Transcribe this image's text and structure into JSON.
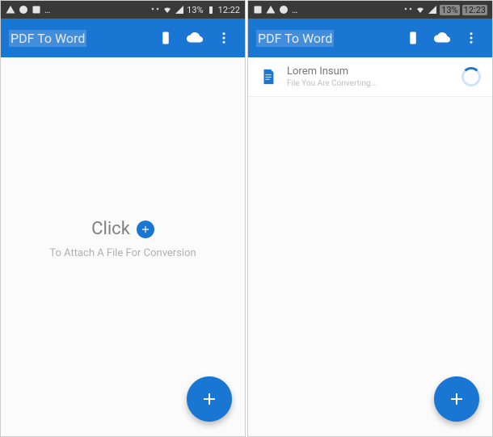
{
  "screen_left": {
    "status": {
      "battery_pct": "13%",
      "clock": "12:22"
    },
    "appbar": {
      "title": "PDF To Word"
    },
    "cta": {
      "click_label": "Click",
      "subtext": "To Attach A File For Conversion"
    }
  },
  "screen_right": {
    "status": {
      "battery_pct": "13%",
      "clock": "12:23"
    },
    "appbar": {
      "title": "PDF To Word"
    },
    "file": {
      "name": "Lorem Insum",
      "status": "File You Are Converting…"
    }
  },
  "colors": {
    "primary": "#1976d2"
  }
}
